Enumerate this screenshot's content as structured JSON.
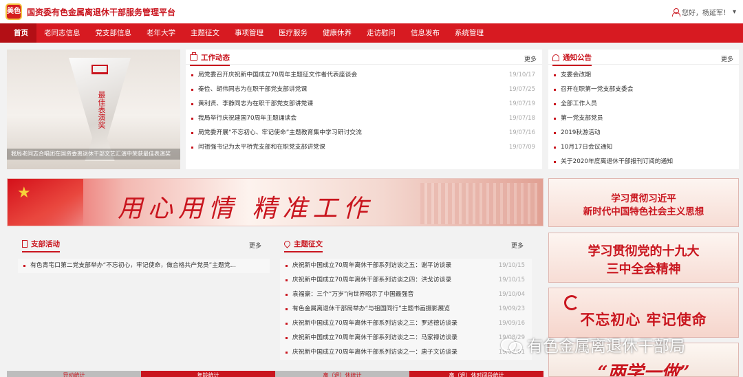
{
  "header": {
    "logo_text": "美色",
    "title": "国资委有色金属离退休干部服务管理平台",
    "greeting": "您好，杨延军！",
    "user_caret": "▾"
  },
  "nav": [
    "首页",
    "老同志信息",
    "党支部信息",
    "老年大学",
    "主题征文",
    "事项管理",
    "医疗服务",
    "健康休养",
    "走访慰问",
    "信息发布",
    "系统管理"
  ],
  "hero": {
    "trophy_text": "最佳表演奖",
    "caption": "我局老同志合唱团在国资委离退休干部文艺汇演中荣获最佳表演奖"
  },
  "work_news": {
    "title": "工作动态",
    "more": "更多",
    "items": [
      {
        "text": "局党委召开庆祝新中国成立70周年主题征文作者代表座谈会",
        "date": "19/10/17"
      },
      {
        "text": "秦俭、胡伟同志为在职干部党支部讲党课",
        "date": "19/07/25"
      },
      {
        "text": "黄利贤、李静同志为在职干部党支部讲党课",
        "date": "19/07/19"
      },
      {
        "text": "我局举行庆祝建国70周年主题诵读会",
        "date": "19/07/18"
      },
      {
        "text": "局党委开展“不忘初心、牢记使命”主题教育集中学习研讨交流",
        "date": "19/07/16"
      },
      {
        "text": "闫祖强书记为太平桥党支部和在职党支部讲党课",
        "date": "19/07/09"
      }
    ]
  },
  "notices": {
    "title": "通知公告",
    "more": "更多",
    "items": [
      "支委会改期",
      "召开在职第一党支部支委会",
      "全部工作人员",
      "第一党支部党员",
      "2019秋游活动",
      "10月17日会议通知",
      "关于2020年度离退休干部报刊订阅的通知"
    ]
  },
  "banner": {
    "slogan": "用心用情  精准工作"
  },
  "side_banners": [
    {
      "line1": "学习贯彻习近平",
      "line2": "新时代中国特色社会主义思想"
    },
    {
      "line1": "学习贯彻党的十九大",
      "line2": "三中全会精神"
    },
    {
      "line1": "不忘初心 牢记使命"
    },
    {
      "line1": "“两学一做”"
    }
  ],
  "branch_activities": {
    "title": "支部活动",
    "more": "更多",
    "items": [
      "有色青宅口第二党支部举办“不忘初心，牢记使命，做合格共产党员”主题党..."
    ]
  },
  "essays": {
    "title": "主题征文",
    "more": "更多",
    "items": [
      {
        "text": "庆祝新中国成立70周年离休干部系列访谈之五：谢平访谈录",
        "date": "19/10/15"
      },
      {
        "text": "庆祝新中国成立70周年离休干部系列访谈之四：洪戈访谈录",
        "date": "19/10/15"
      },
      {
        "text": "袁福豪：三个“万岁”向世界昭示了中国最强音",
        "date": "19/10/04"
      },
      {
        "text": "有色金属离退休干部局举办“与祖国同行”主题书画摄影展览",
        "date": "19/09/23"
      },
      {
        "text": "庆祝新中国成立70周年离休干部系列访谈之三：罗述德访谈录",
        "date": "19/09/16"
      },
      {
        "text": "庆祝新中国成立70周年离休干部系列访谈之二：马家禄访谈录",
        "date": "19/08/29"
      },
      {
        "text": "庆祝新中国成立70周年离休干部系列访谈之一：唐子文访谈录",
        "date": "19/08/01"
      }
    ]
  },
  "watermark": "有色金属离退休干部局",
  "bottom_tabs": [
    "异动统计",
    "年龄统计",
    "离（退）休统计",
    "离（退）休时间段统计"
  ]
}
